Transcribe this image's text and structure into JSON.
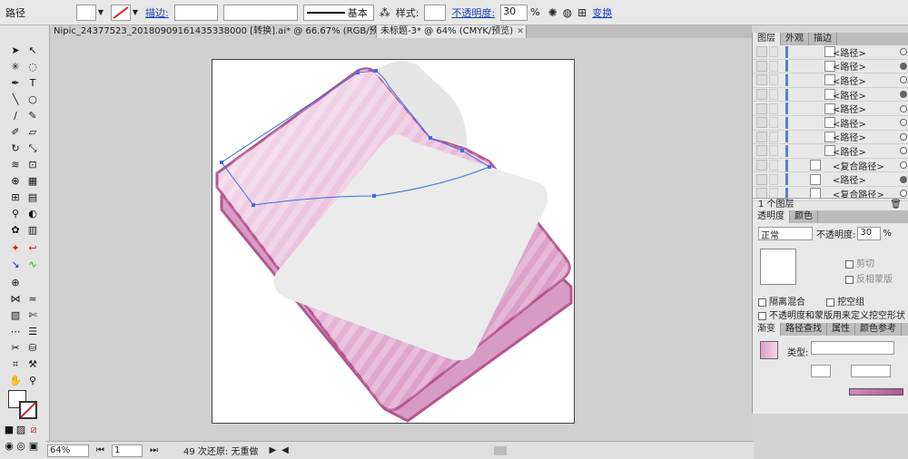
{
  "control_bar": {
    "object_type": "路径",
    "stroke_label": "描边:",
    "stroke_style": "基本",
    "style_label": "样式:",
    "opacity_label": "不透明度:",
    "opacity_value": "30",
    "opacity_unit": "%",
    "transform_label": "变换"
  },
  "tabs": [
    {
      "label": "Nipic_24377523_20180909161435338000 [转换].ai* @ 66.67% (RGB/预览)",
      "close": "✕"
    },
    {
      "label": "未标题-3* @ 64% (CMYK/预览)",
      "close": "✕"
    }
  ],
  "status_bar": {
    "zoom": "64%",
    "page": "1",
    "history": "49 次还原: 无重做"
  },
  "layers_panel": {
    "tabs": [
      "图层",
      "外观",
      "描边"
    ],
    "rows": [
      {
        "name": "<路径>",
        "target": "hollow"
      },
      {
        "name": "<路径>",
        "target": "filled"
      },
      {
        "name": "<路径>",
        "target": "hollow"
      },
      {
        "name": "<路径>",
        "target": "filled"
      },
      {
        "name": "<路径>",
        "target": "hollow"
      },
      {
        "name": "<路径>",
        "target": "hollow"
      },
      {
        "name": "<路径>",
        "target": "hollow"
      },
      {
        "name": "<路径>",
        "target": "hollow"
      },
      {
        "name": "<复合路径>",
        "target": "hollow"
      },
      {
        "name": "<路径>",
        "target": "filled"
      },
      {
        "name": "<复合路径>",
        "target": "hollow"
      }
    ],
    "footer": "1 个图层"
  },
  "transparency_panel": {
    "tabs": [
      "透明度",
      "颜色"
    ],
    "blend_mode": "正常",
    "opacity_label": "不透明度:",
    "opacity_value": "30",
    "opacity_unit": "%",
    "clip_label": "剪切",
    "invert_mask_label": "反相蒙版",
    "isolate_blending_label": "隔离混合",
    "knockout_group_label": "挖空组",
    "opacity_mask_label": "不透明度和蒙版用来定义挖空形状"
  },
  "gradient_panel": {
    "tabs": [
      "渐变",
      "路径查找",
      "属性",
      "颜色参考"
    ],
    "type_label": "类型:"
  },
  "colors": {
    "book_light": "#f2d7ea",
    "book_mid": "#dca1c8",
    "book_edge": "#b4578f",
    "paper": "#ebebeb",
    "path_blue": "#3a6ee8"
  }
}
